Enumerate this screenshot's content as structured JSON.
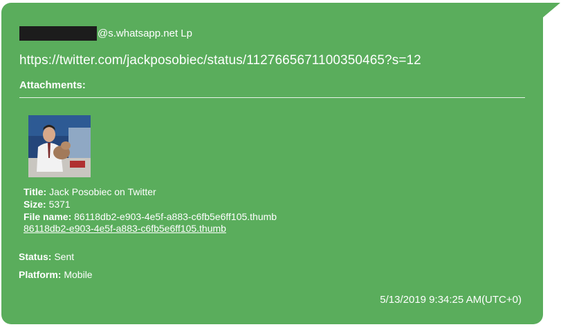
{
  "message": {
    "sender_suffix": "@s.whatsapp.net Lp",
    "url": "https://twitter.com/jackposobiec/status/1127665671100350465?s=12",
    "attachments_label": "Attachments:",
    "attachment": {
      "title_label": "Title:",
      "title_value": "Jack Posobiec  on Twitter",
      "size_label": "Size:",
      "size_value": "5371",
      "file_name_label": "File name:",
      "file_name_value": "86118db2-e903-4e5f-a883-c6fb5e6ff105.thumb",
      "file_link": "86118db2-e903-4e5f-a883-c6fb5e6ff105.thumb"
    },
    "status_label": "Status:",
    "status_value": "Sent",
    "platform_label": "Platform:",
    "platform_value": "Mobile",
    "timestamp": "5/13/2019 9:34:25 AM(UTC+0)"
  },
  "colors": {
    "bubble": "#5aad5c",
    "text": "#ffffff",
    "redaction": "#1c1c1c"
  }
}
